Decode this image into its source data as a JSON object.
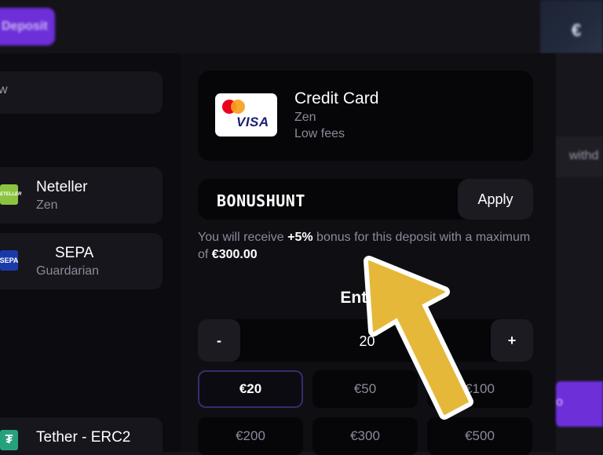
{
  "top_bar": {
    "promo_button_label": "Deposit",
    "right_promo_text": "€"
  },
  "left_list": {
    "search_placeholder": "w",
    "methods": [
      {
        "name": "Neteller",
        "sub": "Zen",
        "logo_text": "NETELLER"
      },
      {
        "name": "SEPA",
        "sub": "Guardarian",
        "logo_text": "SEPA"
      },
      {
        "name": "Tether - ERC2",
        "sub": "",
        "logo_text": "₮"
      }
    ]
  },
  "selected_method": {
    "title": "Credit Card",
    "provider": "Zen",
    "fee_note": "Low fees",
    "logo_text": "VISA"
  },
  "promo": {
    "code": "BONUSHUNT",
    "apply_label": "Apply"
  },
  "bonus_note": {
    "text_1": "You will receive ",
    "bonus_percent": "+5%",
    "text_2": " bonus for this deposit with a maximum of ",
    "max_amount": "€300.00"
  },
  "amount": {
    "title": "Enter a",
    "minus_label": "-",
    "plus_label": "+",
    "value": "20",
    "presets": [
      "€20",
      "€50",
      "€100",
      "€200",
      "€300",
      "€500"
    ],
    "selected_preset": "€20"
  },
  "right_side": {
    "side_text": "withd",
    "purple_text": "o"
  },
  "colors": {
    "accent_purple": "#6d2fd8",
    "arrow_yellow": "#e6b83a",
    "panel_dark": "#060508",
    "muted_text": "#8d8a99"
  }
}
